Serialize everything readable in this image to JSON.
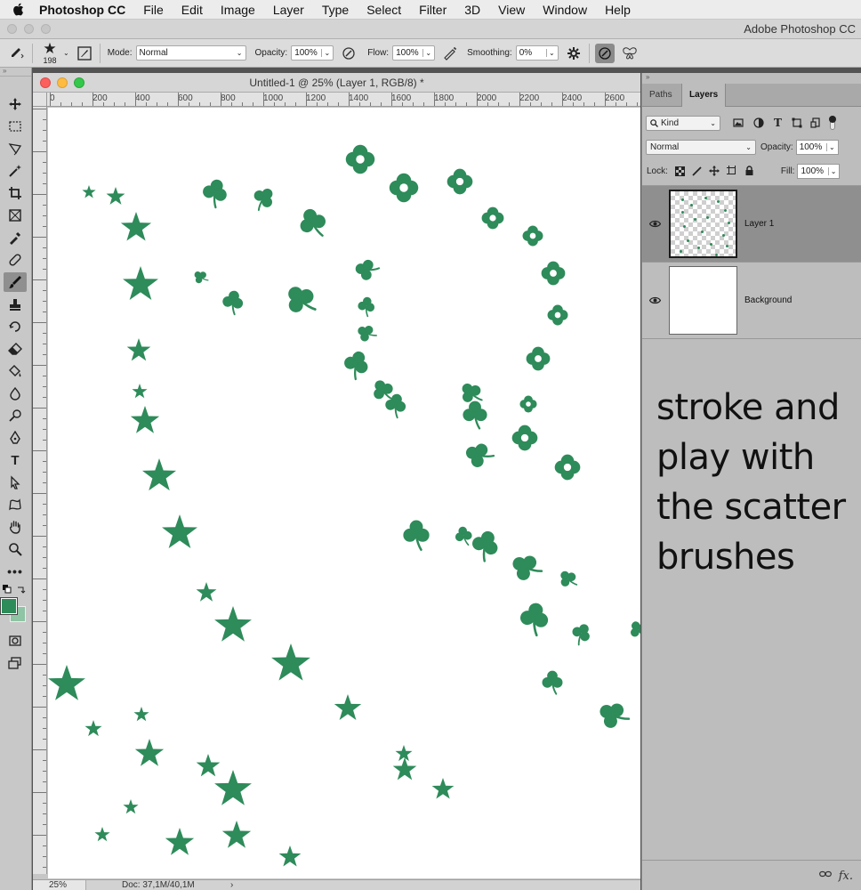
{
  "menubar": {
    "app_name": "Photoshop CC",
    "items": [
      "File",
      "Edit",
      "Image",
      "Layer",
      "Type",
      "Select",
      "Filter",
      "3D",
      "View",
      "Window",
      "Help"
    ]
  },
  "app_title": "Adobe Photoshop CC",
  "options": {
    "brush_size": "198",
    "mode_label": "Mode:",
    "mode_value": "Normal",
    "opacity_label": "Opacity:",
    "opacity_value": "100%",
    "flow_label": "Flow:",
    "flow_value": "100%",
    "smoothing_label": "Smoothing:",
    "smoothing_value": "0%"
  },
  "document": {
    "title": "Untitled-1 @ 25% (Layer 1, RGB/8) *",
    "ruler_labels": [
      "0",
      "200",
      "400",
      "600",
      "800",
      "1000",
      "1200",
      "1400",
      "1600",
      "1800",
      "2000",
      "2200",
      "2400",
      "2600"
    ],
    "status_zoom": "25%",
    "status_doc": "Doc: 37,1M/40,1M",
    "status_arrow": "›"
  },
  "colors": {
    "brush": "#2e8b5a",
    "foreground": "#2e8b5a",
    "background": "#8fc4a4"
  },
  "panels": {
    "tabs": [
      "Paths",
      "Layers"
    ],
    "active_tab": "Layers",
    "filter_kind": "Kind",
    "blend_mode": "Normal",
    "opacity_label": "Opacity:",
    "opacity_value": "100%",
    "lock_label": "Lock:",
    "fill_label": "Fill:",
    "fill_value": "100%",
    "layers": [
      {
        "name": "Layer 1",
        "selected": true
      },
      {
        "name": "Background",
        "selected": false
      }
    ],
    "fx_label": "fx."
  },
  "caption": "stroke and play with the scatter brushes"
}
